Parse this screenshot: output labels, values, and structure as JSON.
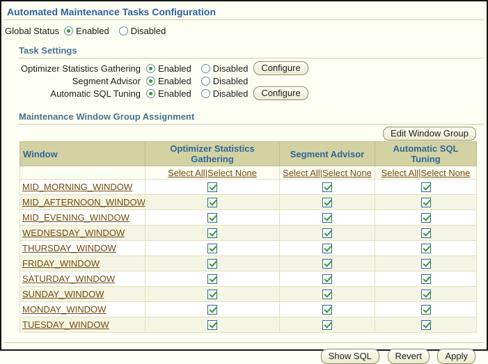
{
  "page": {
    "title": "Automated Maintenance Tasks Configuration"
  },
  "global_status": {
    "label": "Global Status",
    "options": [
      {
        "label": "Enabled",
        "selected": true
      },
      {
        "label": "Disabled",
        "selected": false
      }
    ]
  },
  "radio_labels": {
    "enabled": "Enabled",
    "disabled": "Disabled"
  },
  "task_settings": {
    "heading": "Task Settings",
    "configure_label": "Configure",
    "tasks": [
      {
        "label": "Optimizer Statistics Gathering",
        "selected": "Enabled",
        "has_configure": true
      },
      {
        "label": "Segment Advisor",
        "selected": "Enabled",
        "has_configure": false
      },
      {
        "label": "Automatic SQL Tuning",
        "selected": "Enabled",
        "has_configure": true
      }
    ]
  },
  "window_group": {
    "heading": "Maintenance Window Group Assignment",
    "edit_button_label": "Edit Window Group",
    "table": {
      "columns": [
        "Window",
        "Optimizer Statistics Gathering",
        "Segment Advisor",
        "Automatic SQL Tuning"
      ],
      "select_all_label": "Select All",
      "select_none_label": "Select None",
      "separator": "|",
      "rows": [
        {
          "window": "MID_MORNING_WINDOW",
          "checks": [
            true,
            true,
            true
          ]
        },
        {
          "window": "MID_AFTERNOON_WINDOW",
          "checks": [
            true,
            true,
            true
          ]
        },
        {
          "window": "MID_EVENING_WINDOW",
          "checks": [
            true,
            true,
            true
          ]
        },
        {
          "window": "WEDNESDAY_WINDOW",
          "checks": [
            true,
            true,
            true
          ]
        },
        {
          "window": "THURSDAY_WINDOW",
          "checks": [
            true,
            true,
            true
          ]
        },
        {
          "window": "FRIDAY_WINDOW",
          "checks": [
            true,
            true,
            true
          ]
        },
        {
          "window": "SATURDAY_WINDOW",
          "checks": [
            true,
            true,
            true
          ]
        },
        {
          "window": "SUNDAY_WINDOW",
          "checks": [
            true,
            true,
            true
          ]
        },
        {
          "window": "MONDAY_WINDOW",
          "checks": [
            true,
            true,
            true
          ]
        },
        {
          "window": "TUESDAY_WINDOW",
          "checks": [
            true,
            true,
            true
          ]
        }
      ]
    }
  },
  "footer": {
    "buttons": [
      "Show SQL",
      "Revert",
      "Apply"
    ]
  },
  "colors": {
    "title_blue": "#2F5FA1",
    "section_teal": "#47748C",
    "table_header_bg": "#D2D2A2",
    "table_header_text": "#336699",
    "link_brown": "#73490F",
    "check_green": "#2E9B30",
    "row_alt_bg": "#F5F5E3",
    "rule_beige": "#CDD0A0"
  }
}
